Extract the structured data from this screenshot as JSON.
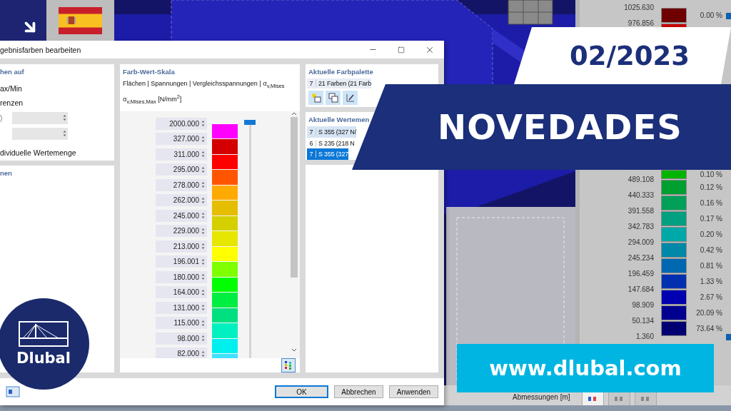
{
  "edition": "02/2023",
  "headline": "NOVEDADES",
  "website": "www.dlubal.com",
  "logo": {
    "name": "Dlubal"
  },
  "legend": {
    "top": {
      "values": [
        "1025.630",
        "976.856"
      ],
      "bands": [
        {
          "color": "#6e0000",
          "percent": "0.00 %"
        },
        {
          "color": "#c80000"
        }
      ]
    },
    "bottom": {
      "values": [
        "489.108",
        "440.333",
        "391.558",
        "342.783",
        "294.009",
        "245.234",
        "196.459",
        "147.684",
        "98.909",
        "50.134",
        "1.360"
      ],
      "bands": [
        {
          "color": "#00b400",
          "percent": "0.10 %"
        },
        {
          "color": "#00a030",
          "percent": "0.12 %"
        },
        {
          "color": "#00a058",
          "percent": "0.16 %"
        },
        {
          "color": "#00a080",
          "percent": "0.17 %"
        },
        {
          "color": "#00a8a8",
          "percent": "0.20 %"
        },
        {
          "color": "#0088a8",
          "percent": "0.42 %"
        },
        {
          "color": "#0068b0",
          "percent": "0.81 %"
        },
        {
          "color": "#0030b0",
          "percent": "1.33 %"
        },
        {
          "color": "#0000b0",
          "percent": "2.67 %"
        },
        {
          "color": "#000090",
          "percent": "20.09 %"
        },
        {
          "color": "#000070",
          "percent": "73.64 %"
        }
      ]
    }
  },
  "bottom_bar": {
    "label": "Abmessungen [m]",
    "tabs": [
      {
        "selected": true
      },
      {
        "selected": false
      },
      {
        "selected": false
      }
    ]
  },
  "dialog": {
    "title": "gebnisfarben bearbeiten",
    "left": {
      "heading": "hen auf",
      "options": [
        "ax/Min",
        "renzen"
      ],
      "fields": [
        {
          "label": ")",
          "disabled": true
        },
        {
          "disabled": true
        }
      ],
      "note": "dividuelle Wertemenge",
      "lower_heading": "nen"
    },
    "scale": {
      "heading": "Farb-Wert-Skala",
      "subtitle_lines": [
        "Flächen | Spannungen | Vergleichsspannungen | σ$_{v,Mises}$",
        "σ$_{v,Mises,Max}$ [N/mm$^{2}$]"
      ],
      "entries": [
        {
          "value": "2000.000",
          "color": "#ff00ff"
        },
        {
          "value": "327.000",
          "color": "#d40000"
        },
        {
          "value": "311.000",
          "color": "#ff0000"
        },
        {
          "value": "295.000",
          "color": "#ff5500"
        },
        {
          "value": "278.000",
          "color": "#ffaa00"
        },
        {
          "value": "262.000",
          "color": "#e6be00"
        },
        {
          "value": "245.000",
          "color": "#d4d000"
        },
        {
          "value": "229.000",
          "color": "#e6e600"
        },
        {
          "value": "213.000",
          "color": "#ffff00"
        },
        {
          "value": "196.001",
          "color": "#80ff00"
        },
        {
          "value": "180.000",
          "color": "#00ff00"
        },
        {
          "value": "164.000",
          "color": "#00ee40"
        },
        {
          "value": "131.000",
          "color": "#00e080"
        },
        {
          "value": "115.000",
          "color": "#00f0c0"
        },
        {
          "value": "98.000",
          "color": "#00f0f0"
        },
        {
          "value": "82.000",
          "color": "#40e0ff"
        }
      ],
      "slider": {
        "level": 1
      }
    },
    "palette": {
      "heading": "Aktuelle Farbpalette",
      "number": "7",
      "name": "21 Farben (21 Farb"
    },
    "value_set": {
      "heading": "Aktuelle Wertemen",
      "current": {
        "number": "7",
        "name": "S 355 (327 N/"
      },
      "options": [
        {
          "number": "6",
          "name": "S 235 (218 N",
          "selected": false
        },
        {
          "number": "7",
          "name": "S 355 (327",
          "selected": true
        }
      ]
    },
    "buttons": [
      {
        "label": "OK",
        "default": true
      },
      {
        "label": "Abbrechen",
        "default": false
      },
      {
        "label": "Anwenden",
        "default": false
      }
    ]
  }
}
